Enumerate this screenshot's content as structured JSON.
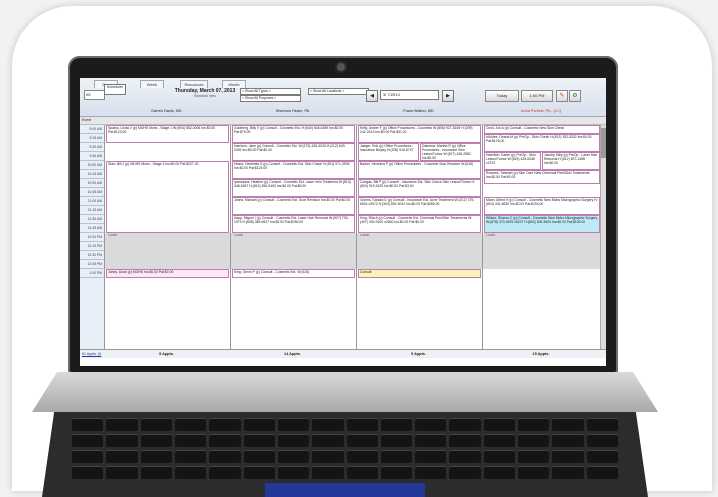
{
  "toolbar": {
    "tabs": [
      "Day",
      "Week",
      "Resources",
      "Month"
    ],
    "date_box": "05",
    "scheduler_label": "Scheduler",
    "date_heading": "Thursday, March 07, 2013",
    "standard_view": "Standard View",
    "appt_types_combo": "< Show All Types >",
    "purposes_combo": "< Show All Purposes >",
    "locations_combo": "< Show All Locations >",
    "date_combo": "3/ 7/2013",
    "today_label": "Today",
    "time_label": "1:00 PM"
  },
  "providers": [
    "Darren Davis, MD",
    "Shannon Hearn, PA",
    "Frank Walton, MD",
    "Anna Perkins, PA - (LC)"
  ],
  "event_label": "Event",
  "times": [
    "9:00 AM",
    "9:15 AM",
    "9:30 AM",
    "9:45 AM",
    "10:00 AM",
    "10:15 AM",
    "10:30 AM",
    "10:45 AM",
    "11:00 AM",
    "11:15 AM",
    "11:30 AM",
    "11:45 AM",
    "12:00 PM",
    "12:15 PM",
    "12:30 PM",
    "12:45 PM",
    "1:00 PM"
  ],
  "columns": [
    {
      "appointments": [
        {
          "text": "Sparks, Linda V (p) MOHS Mohs - Stage 1 W:(504) 852-4006 Ins:$0.00 Pat:$123.00"
        },
        {
          "text": "Starr, Bill J (p) MOHS Mohs - Stage 2 Ins:$0.00 Pat:$227.00"
        },
        {
          "text": "Johns, Dush (p) MOHS Ins:$0.00 Pat:$0.00"
        }
      ],
      "lunch": "Lunch",
      "count": "5 Appts."
    },
    {
      "appointments": [
        {
          "text": "Goldberg, Billy V (p) Consult - Cosmetic Est. H:(540) 545-6459 Ins:$0.00 Pat:$79.00"
        },
        {
          "text": "Harrison, Jane (p) Consult - Cosmetic Est. W:(273) 436-4343 H:(212) 643-3492 Ins:$0.00 Pat:$0.00"
        },
        {
          "text": "Heard, Henrietta G (p) Consult - Cosmetic Est. Skin Check H:(301) 971-3905 Ins:$0.00 Pat:$124.00"
        },
        {
          "text": "Iparraluna, Heather (p) Consult - Cosmetic Est. Laser Vein Treatment W:(813) 346-9457 H:(813) 396-9463 Ins:$0.00 Pat:$0.00"
        },
        {
          "text": "Johns, Michael (p) Consult - Cosmetic Est. Scar Revision Ins:$0.00 Pat:$0.00"
        },
        {
          "text": "Kapp, Miguel I (p) Consult - Cosmetic Est. Laser Hair Removal W:(907) 726-1973 H:(608) 389-6527 Ins:$0.00 Pat:$250.00"
        },
        {
          "text": "King, Glenn P (p) Consult - Cosmetic Est. W:(615)"
        }
      ],
      "lunch": "Lunch",
      "count": "14 Appts."
    },
    {
      "appointments": [
        {
          "text": "Kelly, Amber F (p) Office Procedures - Cosmetic W:(805) 927-5169 H:(209) 242-2413 Ins:$0.00 Pat:$31.00"
        },
        {
          "text": "Jaeger, Rob (p) Office Procedures - Insurance Biopsy H:(205) 516-6747"
        },
        {
          "text": "Dabelow, Martha R (p) Office Procedures - Insurance Skin Lesion/Tumor W:(517) 436-2982 Ins:$0.00"
        },
        {
          "text": "Barker, Veronica P (p) Office Procedures - Cosmetic Scar Revision W:(618)"
        },
        {
          "text": "Congas, Bill P (p) Consult - Insurance Est. Skin Check Skin Lesion/Tumor H:(804) 919-2429 Ins:$0.00 Pat:$3.00"
        },
        {
          "text": "Givens, Sandra D (p) Consult - Insurance Est. Acne Treatment W:(212) 729-6924 x3972 H:(304) 892-5012 Ins:$0.00 Pat:$285.00"
        },
        {
          "text": "King, Rita A (p) Consult - Cosmetic Est. Chemical Peel/Skin Treatments W:(457) 430-9109 x2600 Ins:$0.00 Pat:$0.00"
        },
        {
          "text": "Consult"
        }
      ],
      "lunch": "Lunch",
      "count": "9 Appts."
    },
    {
      "appointments": [
        {
          "text": "Cecil, Jon A (p) Consult - Cosmetic New Skin Check"
        },
        {
          "text": "McAfee, Deana M (p) PreOp - Skin Check H:(512) 352-5332 Ins:$0.00 Pat:$126.00"
        },
        {
          "text": "Hamilton, Karen (p) PreOp - Skin Lesion/Tumor W:(819) 425-6348 x2374"
        },
        {
          "text": "Jacoby, Billy (p) PreOp - Laser Hair Removal H:(512) 697-1488 Ins:$0.00"
        },
        {
          "text": "Romans, Tatanah (p) Skin Care New Chemical Peel/Skin Treatments Ins:$0.00 Pat:$0.00"
        },
        {
          "text": "Mann, Alfred H (p) Consult - Cosmetic New Mohs Micrographic Surgery H:(803) 431-5630 Ins:$0.00 Pat:$194.00"
        },
        {
          "text": "Wilson, Sharon C (p) Consult - Cosmetic New Mohs Micrographic Surgery W:(878) 370-4876 x5227 H:(803) 305-3604 Ins:$0.00 Pat:$105.00"
        }
      ],
      "lunch": "Lunch",
      "count": "15 Appts."
    }
  ],
  "footer": {
    "link": "61 Appts. (f)"
  },
  "colors": {
    "appt_border": "#c07cb4",
    "highlight": "#fdf3b8",
    "cyan_appt": "#bfeaf5",
    "provider_accent": "#c0392b"
  }
}
